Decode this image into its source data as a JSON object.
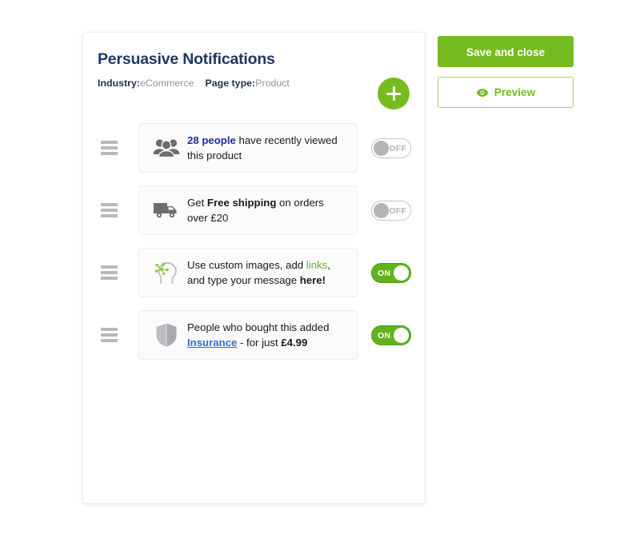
{
  "panel": {
    "title": "Persuasive Notifications",
    "meta": {
      "industry_label": "Industry:",
      "industry_value": "eCommerce",
      "page_type_label": "Page type:",
      "page_type_value": "Product"
    },
    "add_button_icon": "plus-icon"
  },
  "notifications": [
    {
      "icon": "people-group-icon",
      "text_parts": [
        {
          "text": "28 people",
          "style": "blue-bold"
        },
        {
          "text": " have recently viewed this product",
          "style": "normal"
        }
      ],
      "toggle_state": "OFF",
      "toggle_label": "OFF"
    },
    {
      "icon": "delivery-truck-icon",
      "text_parts": [
        {
          "text": "Get ",
          "style": "normal"
        },
        {
          "text": "Free shipping",
          "style": "bold"
        },
        {
          "text": " on orders over £20",
          "style": "normal"
        }
      ],
      "toggle_state": "OFF",
      "toggle_label": "OFF"
    },
    {
      "icon": "idea-head-icon",
      "text_parts": [
        {
          "text": "Use custom images, add ",
          "style": "normal"
        },
        {
          "text": "links",
          "style": "green"
        },
        {
          "text": ", and type your message ",
          "style": "normal"
        },
        {
          "text": "here!",
          "style": "bold"
        }
      ],
      "toggle_state": "ON",
      "toggle_label": "ON"
    },
    {
      "icon": "shield-icon",
      "text_parts": [
        {
          "text": "People who bought this added ",
          "style": "normal"
        },
        {
          "text": "Insurance",
          "style": "link"
        },
        {
          "text": " - for just ",
          "style": "normal"
        },
        {
          "text": "£4.99",
          "style": "bold"
        }
      ],
      "toggle_state": "ON",
      "toggle_label": "ON"
    }
  ],
  "actions": {
    "save_label": "Save and close",
    "preview_label": "Preview",
    "preview_icon": "eye-icon"
  },
  "colors": {
    "brand_green": "#76bc21",
    "toggle_on_green": "#5fb41a",
    "title_navy": "#1f3864",
    "link_blue": "#2a6ddb",
    "highlight_blue": "#1b2ea0",
    "icon_gray": "#6d6d6d"
  }
}
